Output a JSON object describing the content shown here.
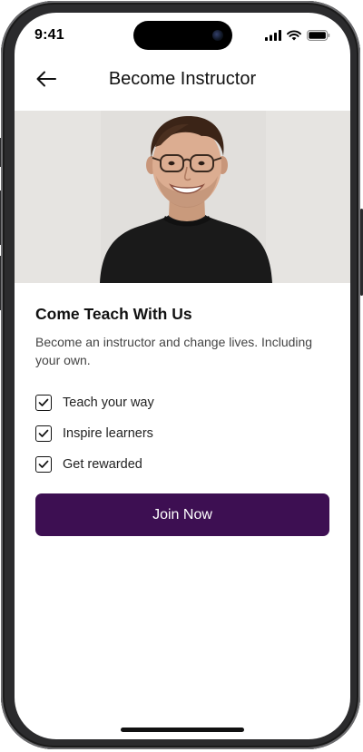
{
  "status_bar": {
    "time": "9:41",
    "icons": [
      "cellular-signal-icon",
      "wifi-icon",
      "battery-icon"
    ]
  },
  "header": {
    "back_icon": "arrow-left-icon",
    "title": "Become Instructor"
  },
  "hero": {
    "image_subject": "smiling man with glasses in black t-shirt"
  },
  "content": {
    "title": "Come Teach With Us",
    "subtitle": "Become an instructor and change lives. Including your own.",
    "features": [
      {
        "label": "Teach your way",
        "icon": "checkbox-checked-icon"
      },
      {
        "label": "Inspire learners",
        "icon": "checkbox-checked-icon"
      },
      {
        "label": "Get rewarded",
        "icon": "checkbox-checked-icon"
      }
    ]
  },
  "cta": {
    "label": "Join Now"
  },
  "colors": {
    "primary_button": "#3d0f52",
    "hero_background": "#e6e4e1",
    "text_primary": "#111111",
    "text_secondary": "#444444"
  }
}
